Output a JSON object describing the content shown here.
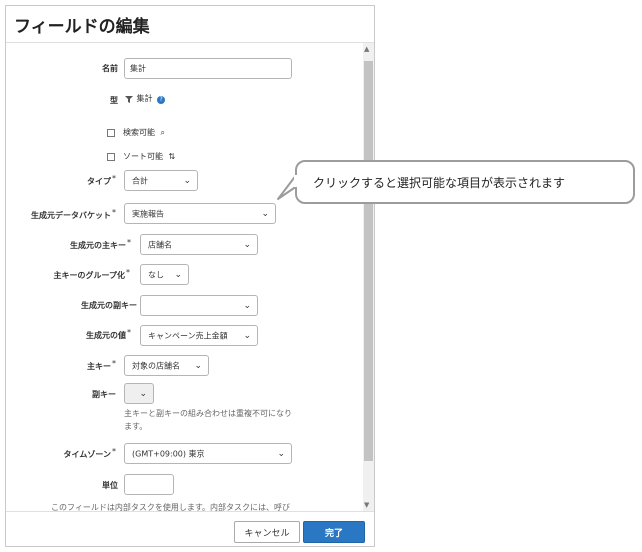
{
  "dialog": {
    "title": "フィールドの編集",
    "cancel_label": "キャンセル",
    "done_label": "完了"
  },
  "form": {
    "name": {
      "label": "名前",
      "value": "集計"
    },
    "type": {
      "label": "型",
      "value": "集計"
    },
    "searchable": {
      "label": "検索可能",
      "checked": false
    },
    "sortable": {
      "label": "ソート可能",
      "checked": false
    },
    "typeSelect": {
      "label": "タイプ",
      "value": "合計"
    },
    "sourceBucket": {
      "label": "生成元データバケット",
      "value": "実施報告"
    },
    "sourcePrimaryKey": {
      "label": "生成元の主キー",
      "value": "店舗名"
    },
    "primaryKeyGrouping": {
      "label": "主キーのグループ化",
      "value": "なし"
    },
    "sourceSecondaryKey": {
      "label": "生成元の副キー",
      "value": ""
    },
    "sourceValue": {
      "label": "生成元の値",
      "value": "キャンペーン売上金額"
    },
    "primaryKey": {
      "label": "主キー",
      "value": "対象の店舗名"
    },
    "secondaryKey": {
      "label": "副キー",
      "value": "",
      "help": "主キーと副キーの組み合わせは重複不可になります。"
    },
    "timezone": {
      "label": "タイムゾーン",
      "value": "(GMT+09:00) 東京"
    },
    "unit": {
      "label": "単位",
      "value": ""
    },
    "footnote": "このフィールドは内部タスクを使用します。内部タスクには、呼び"
  },
  "required_mark": "*",
  "callout": {
    "text": "クリックすると選択可能な項目が表示されます"
  },
  "colors": {
    "primary": "#2a78c3",
    "border": "#b5b5b5",
    "scrollbar": "#c3c3c3",
    "callout_border": "#9c9c9c"
  }
}
